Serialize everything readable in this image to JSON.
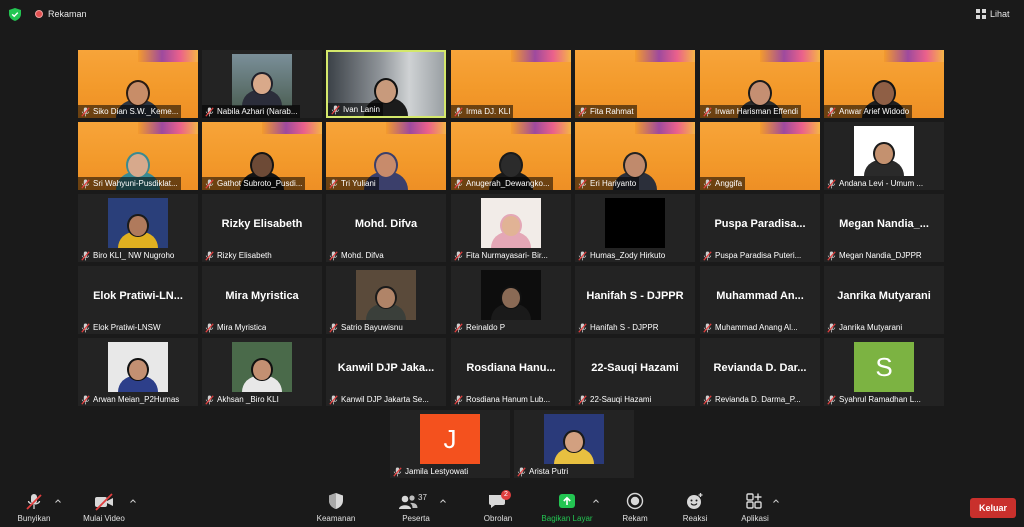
{
  "topbar": {
    "recording_label": "Rekaman",
    "view_label": "Lihat"
  },
  "participants": [
    {
      "name": "Siko Dian S.W._Keme...",
      "kind": "video",
      "bg": "orange",
      "skin": "#c88d68",
      "hair": "#2a1b12",
      "shirt": "#2c3440"
    },
    {
      "name": "Nabila Azhari (Narab...",
      "kind": "video",
      "bg": "photo-nature",
      "skin": "#d9a98a",
      "hair": "#20202a",
      "shirt": "#2b2d3a"
    },
    {
      "name": "Ivan Lanin",
      "kind": "video",
      "bg": "room",
      "skin": "#c89a7c",
      "hair": "#111",
      "shirt": "#1b1b1b",
      "speaking": true
    },
    {
      "name": "Irma DJ. KLI",
      "kind": "video",
      "bg": "orange",
      "empty": true
    },
    {
      "name": "Fita Rahmat",
      "kind": "video",
      "bg": "orange",
      "empty": true
    },
    {
      "name": "Irwan Harisman Effendi",
      "kind": "video",
      "bg": "orange",
      "skin": "#c58f72",
      "hair": "#1a1a1a",
      "shirt": "#2b2b2b"
    },
    {
      "name": "Anwar Arief Widodo",
      "kind": "video",
      "bg": "orange",
      "skin": "#8f5f45",
      "hair": "#141414",
      "shirt": "#1f1f1f"
    },
    {
      "name": "Sri Wahyuni-Pusdiklat...",
      "kind": "video",
      "bg": "orange",
      "skin": "#d7a98c",
      "hair": "#3a8a92",
      "shirt": "#3a8a92"
    },
    {
      "name": "Gathot Subroto_Pusdi...",
      "kind": "video",
      "bg": "orange",
      "skin": "#6d4a36",
      "hair": "#141414",
      "shirt": "#141414"
    },
    {
      "name": "Tri Yuliani",
      "kind": "video",
      "bg": "orange",
      "skin": "#c88b6b",
      "hair": "#3b3f6b",
      "shirt": "#3b3f6b"
    },
    {
      "name": "Anugerah_Dewangko...",
      "kind": "video",
      "bg": "orange",
      "skin": "#2b2b2b",
      "hair": "#1a1a1a",
      "shirt": "#1a1a1a"
    },
    {
      "name": "Eri Hariyanto",
      "kind": "video",
      "bg": "orange",
      "skin": "#c08a6c",
      "hair": "#222",
      "shirt": "#2b2f3a"
    },
    {
      "name": "Anggifa",
      "kind": "video",
      "bg": "orange",
      "empty": true
    },
    {
      "name": "Andana Levi - Umum ...",
      "kind": "photo",
      "photo_bg": "#ffffff",
      "skin": "#c4916f",
      "hair": "#1b1b1b",
      "shirt": "#2a2a2a"
    },
    {
      "name": "Biro KLI_ NW Nugroho",
      "kind": "photo",
      "photo_bg": "#2a3f7a",
      "skin": "#b07a5c",
      "hair": "#1a1a1a",
      "shirt": "#e0b020"
    },
    {
      "name": "Rizky Elisabeth",
      "kind": "name",
      "big": "Rizky Elisabeth"
    },
    {
      "name": "Mohd. Difva",
      "kind": "name",
      "big": "Mohd. Difva"
    },
    {
      "name": "Fita Nurmayasari- Bir...",
      "kind": "photo",
      "photo_bg": "#f2ece8",
      "skin": "#e1b395",
      "hair": "#e4a7b6",
      "shirt": "#e4a7b6"
    },
    {
      "name": "Humas_Zody Hirkuto",
      "kind": "photo",
      "photo_bg": "#000000",
      "empty": true
    },
    {
      "name": "Puspa Paradisa Puteri...",
      "kind": "name",
      "big": "Puspa Paradisa..."
    },
    {
      "name": "Megan Nandia_DJPPR",
      "kind": "name",
      "big": "Megan Nandia_..."
    },
    {
      "name": "Elok Pratiwi-LNSW",
      "kind": "name",
      "big": "Elok Pratiwi-LN..."
    },
    {
      "name": "Mira Myristica",
      "kind": "name",
      "big": "Mira Myristica"
    },
    {
      "name": "Satrio Bayuwisnu",
      "kind": "photo",
      "photo_bg": "#5a4a3a",
      "skin": "#b08468",
      "hair": "#1b1b1b",
      "shirt": "#3a3f3a"
    },
    {
      "name": "Reinaldo P",
      "kind": "photo",
      "photo_bg": "#0d0d0d",
      "skin": "#8a6a55",
      "hair": "#111",
      "shirt": "#1a1a1a"
    },
    {
      "name": "Hanifah S - DJPPR",
      "kind": "name",
      "big": "Hanifah S - DJPPR"
    },
    {
      "name": "Muhammad Anang Al...",
      "kind": "name",
      "big": "Muhammad An..."
    },
    {
      "name": "Janrika Mutyarani",
      "kind": "name",
      "big": "Janrika Mutyarani"
    },
    {
      "name": "Arwan Meian_P2Humas",
      "kind": "photo",
      "photo_bg": "#e8e8e8",
      "skin": "#c39072",
      "hair": "#111",
      "shirt": "#2d3f8a"
    },
    {
      "name": "Akhsan _Biro KLI",
      "kind": "photo",
      "photo_bg": "#4a6a4a",
      "skin": "#c39072",
      "hair": "#111",
      "shirt": "#e8e8e8"
    },
    {
      "name": "Kanwil DJP Jakarta Se...",
      "kind": "name",
      "big": "Kanwil DJP Jaka..."
    },
    {
      "name": "Rosdiana Hanum Lub...",
      "kind": "name",
      "big": "Rosdiana Hanu..."
    },
    {
      "name": "22-Sauqi Hazami",
      "kind": "name",
      "big": "22-Sauqi Hazami"
    },
    {
      "name": "Revianda D. Darma_P...",
      "kind": "name",
      "big": "Revianda D. Dar..."
    },
    {
      "name": "Syahrul Ramadhan L...",
      "kind": "avatar",
      "letter": "S",
      "avatar_color": "#7cb342"
    },
    {
      "name": "Jamila Lestyowati",
      "kind": "avatar",
      "letter": "J",
      "avatar_color": "#f4511e"
    },
    {
      "name": "Arista Putri",
      "kind": "photo",
      "photo_bg": "#2a3a7a",
      "skin": "#d2a080",
      "hair": "#1a1a1a",
      "shirt": "#e8c040"
    }
  ],
  "toolbar": {
    "mute_label": "Bunyikan",
    "video_label": "Mulai Video",
    "security_label": "Keamanan",
    "participants_label": "Peserta",
    "participants_count": "37",
    "chat_label": "Obrolan",
    "chat_badge": "2",
    "share_label": "Bagikan Layar",
    "record_label": "Rekam",
    "reactions_label": "Reaksi",
    "apps_label": "Aplikasi",
    "leave_label": "Keluar"
  },
  "colors": {
    "share_accent": "#23c552",
    "leave_red": "#c9302c",
    "speaker_border": "#d4e86b"
  }
}
